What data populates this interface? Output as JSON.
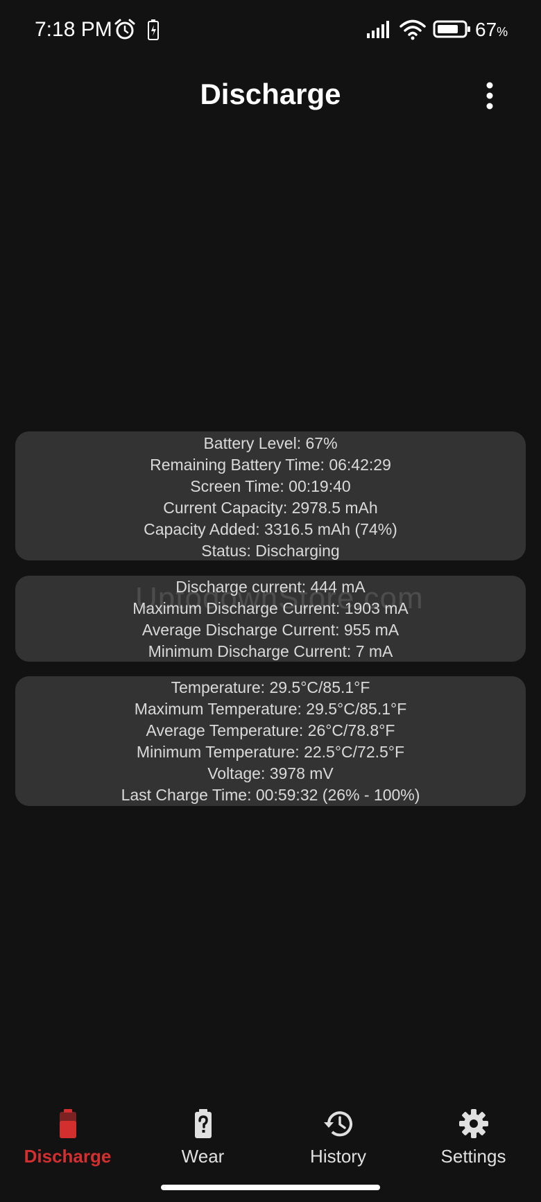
{
  "status_bar": {
    "time": "7:18 PM",
    "battery_percent": "67",
    "battery_percent_unit": "%",
    "icons": [
      "alarm-icon",
      "charging-icon",
      "signal-icon",
      "wifi-icon",
      "battery-icon"
    ]
  },
  "app_bar": {
    "title": "Discharge",
    "menu_icon": "more-vert-icon"
  },
  "cards": {
    "battery": [
      "Battery Level: 67%",
      "Remaining Battery Time: 06:42:29",
      "Screen Time: 00:19:40",
      "Current Capacity: 2978.5 mAh",
      "Capacity Added: 3316.5 mAh (74%)",
      "Status: Discharging"
    ],
    "current": [
      "Discharge current: 444 mA",
      "Maximum Discharge Current: 1903 mA",
      "Average Discharge Current: 955 mA",
      "Minimum Discharge Current: 7 mA"
    ],
    "temperature": [
      "Temperature: 29.5°C/85.1°F",
      "Maximum Temperature: 29.5°C/85.1°F",
      "Average Temperature: 26°C/78.8°F",
      "Minimum Temperature: 22.5°C/72.5°F",
      "Voltage: 3978 mV",
      "Last Charge Time: 00:59:32 (26% - 100%)"
    ]
  },
  "watermark": "UptodownStore.com",
  "bottom_nav": {
    "items": [
      {
        "label": "Discharge",
        "icon": "battery-icon",
        "active": true
      },
      {
        "label": "Wear",
        "icon": "battery-unknown-icon",
        "active": false
      },
      {
        "label": "History",
        "icon": "history-icon",
        "active": false
      },
      {
        "label": "Settings",
        "icon": "gear-icon",
        "active": false
      }
    ]
  },
  "colors": {
    "background": "#121212",
    "card": "#333333",
    "accent": "#d32f2f",
    "text": "#dadada"
  }
}
